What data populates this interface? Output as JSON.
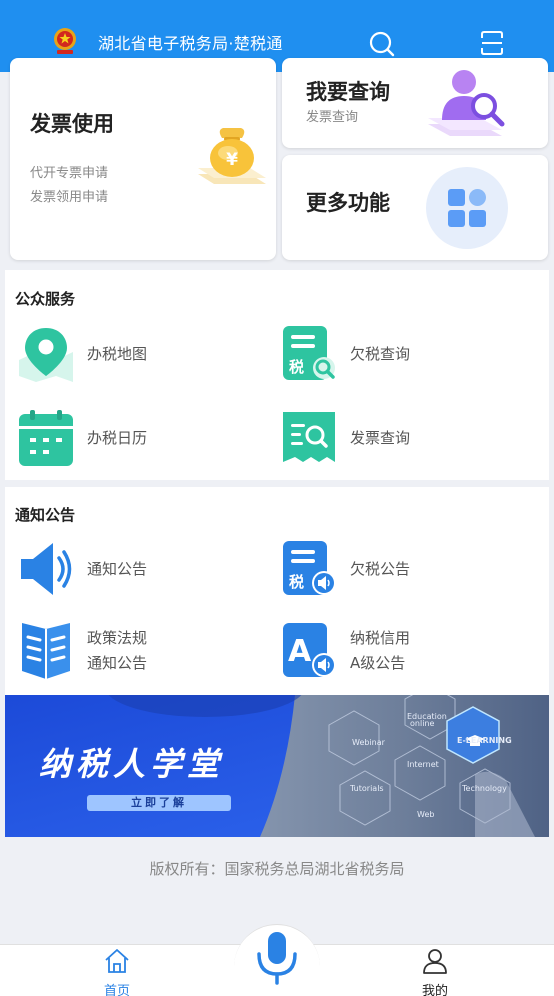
{
  "header": {
    "title": "湖北省电子税务局·楚税通",
    "emblem_icon": "national-emblem-icon",
    "search_icon": "search-icon",
    "scan_icon": "scan-icon"
  },
  "cards": {
    "invoice": {
      "title": "发票使用",
      "links": [
        "代开专票申请",
        "发票领用申请"
      ],
      "icon": "money-bag-icon"
    },
    "query": {
      "title": "我要查询",
      "subtitle": "发票查询",
      "icon": "user-search-icon"
    },
    "more": {
      "title": "更多功能",
      "icon": "app-grid-icon"
    }
  },
  "public_service": {
    "title": "公众服务",
    "items": [
      {
        "label": "办税地图",
        "icon": "map-pin-icon"
      },
      {
        "label": "欠税查询",
        "icon": "tax-doc-search-icon"
      },
      {
        "label": "办税日历",
        "icon": "calendar-icon"
      },
      {
        "label": "发票查询",
        "icon": "invoice-search-icon"
      }
    ]
  },
  "notices": {
    "title": "通知公告",
    "items": [
      {
        "label": "通知公告",
        "icon": "speaker-icon"
      },
      {
        "label": "欠税公告",
        "icon": "tax-doc-announce-icon"
      },
      {
        "label_line1": "政策法规",
        "label_line2": "通知公告",
        "icon": "open-book-icon"
      },
      {
        "label_line1": "纳税信用",
        "label_line2": "A级公告",
        "icon": "credit-a-icon"
      }
    ]
  },
  "banner": {
    "title": "纳税人学堂",
    "button": "立即了解",
    "network_labels": [
      "Education online",
      "Webinar",
      "E-LEARNING",
      "Internet",
      "Tutorials",
      "Technology",
      "Web"
    ]
  },
  "copyright": "版权所有：国家税务总局湖北省税务局",
  "tabbar": {
    "home": {
      "label": "首页",
      "icon": "home-icon"
    },
    "voice": {
      "icon": "microphone-icon"
    },
    "mine": {
      "label": "我的",
      "icon": "user-icon"
    }
  },
  "colors": {
    "header_blue": "#1f8ff0",
    "icon_teal": "#2ec4a0",
    "icon_blue": "#2a82e4",
    "tab_active": "#2a82e4"
  }
}
